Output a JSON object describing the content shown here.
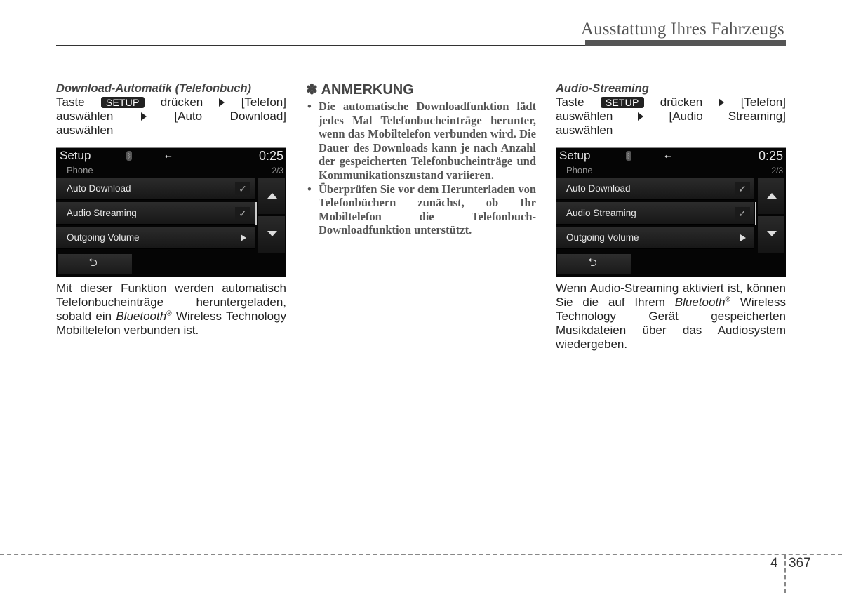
{
  "header": {
    "title": "Ausstattung Ihres Fahrzeugs"
  },
  "left": {
    "section_title": "Download-Automatik (Telefonbuch)",
    "instr": {
      "l1_a": "Taste",
      "setup": "SETUP",
      "l1_b": "drücken",
      "l1_c": "[Telefon]",
      "l2_a": "auswählen",
      "l2_b": "[Auto",
      "l2_c": "Download]",
      "l3": "auswählen"
    },
    "screen": {
      "title": "Setup",
      "time": "0:25",
      "subtitle": "Phone",
      "page": "2/3",
      "rows": [
        {
          "label": "Auto Download",
          "state": "checked"
        },
        {
          "label": "Audio Streaming",
          "state": "checked"
        },
        {
          "label": "Outgoing Volume",
          "state": "submenu"
        }
      ],
      "check_glyph": "✓",
      "back_glyph": "⮌",
      "bt_glyph": "ᛒ",
      "usb_glyph": "⭠"
    },
    "desc_1": "Mit dieser Funktion werden automatisch Telefonbucheinträge heruntergeladen, sobald ein",
    "desc_bt": "Bluetooth",
    "desc_reg": "®",
    "desc_2": "Wireless Technology Mobiltelefon verbunden ist."
  },
  "note": {
    "title": "✽ ANMERKUNG",
    "items": [
      "Die automatische Downloadfunktion lädt jedes Mal Telefonbucheinträge herunter, wenn das Mobiltelefon verbunden wird. Die Dauer des Downloads kann je nach Anzahl der gespeicherten Telefonbucheinträge und Kommunikationszustand variieren.",
      "Überprüfen Sie vor dem Herunterladen von Telefonbüchern zunächst, ob Ihr Mobiltelefon die Telefonbuch-Downloadfunktion unterstützt."
    ]
  },
  "right": {
    "section_title": "Audio-Streaming",
    "instr": {
      "l1_a": "Taste",
      "setup": "SETUP",
      "l1_b": "drücken",
      "l1_c": "[Telefon]",
      "l2_a": "auswählen",
      "l2_b": "[Audio",
      "l2_c": "Streaming]",
      "l3": "auswählen"
    },
    "screen": {
      "title": "Setup",
      "time": "0:25",
      "subtitle": "Phone",
      "page": "2/3",
      "rows": [
        {
          "label": "Auto Download",
          "state": "checked"
        },
        {
          "label": "Audio Streaming",
          "state": "checked"
        },
        {
          "label": "Outgoing Volume",
          "state": "submenu"
        }
      ],
      "check_glyph": "✓",
      "back_glyph": "⮌",
      "bt_glyph": "ᛒ",
      "usb_glyph": "⭠"
    },
    "desc_1": "Wenn Audio-Streaming aktiviert ist, können Sie die auf Ihrem",
    "desc_bt": "Bluetooth",
    "desc_reg": "®",
    "desc_2": "Wireless Technology Gerät gespeicherten Musikdateien über das Audiosystem wiedergeben."
  },
  "footer": {
    "chapter": "4",
    "page": "367"
  }
}
